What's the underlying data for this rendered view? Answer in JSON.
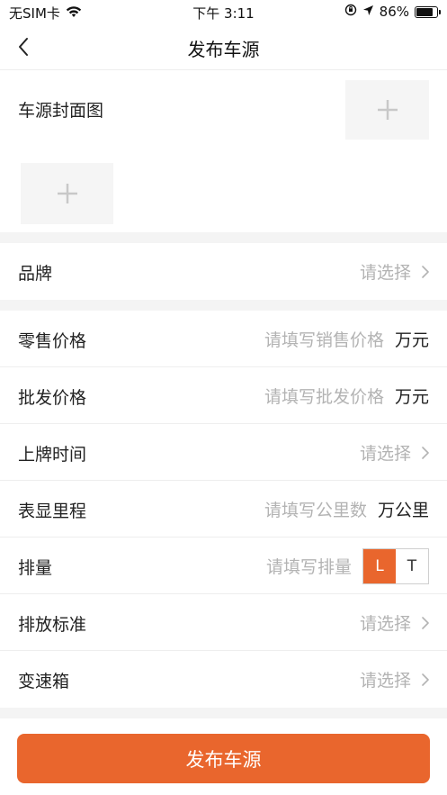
{
  "status": {
    "carrier": "无SIM卡",
    "time": "下午 3:11",
    "battery": "86%",
    "battery_level": 0.86
  },
  "nav": {
    "title": "发布车源"
  },
  "cover": {
    "label": "车源封面图"
  },
  "brand": {
    "label": "品牌",
    "placeholder": "请选择"
  },
  "retail_price": {
    "label": "零售价格",
    "placeholder": "请填写销售价格",
    "unit": "万元"
  },
  "wholesale_price": {
    "label": "批发价格",
    "placeholder": "请填写批发价格",
    "unit": "万元"
  },
  "registration_date": {
    "label": "上牌时间",
    "placeholder": "请选择"
  },
  "mileage": {
    "label": "表显里程",
    "placeholder": "请填写公里数",
    "unit": "万公里"
  },
  "displacement": {
    "label": "排量",
    "placeholder": "请填写排量",
    "options": [
      "L",
      "T"
    ],
    "selected": "L"
  },
  "emission_standard": {
    "label": "排放标准",
    "placeholder": "请选择"
  },
  "gearbox": {
    "label": "变速箱",
    "placeholder": "请选择"
  },
  "submit": {
    "label": "发布车源"
  },
  "colors": {
    "accent": "#e9662d",
    "placeholder": "#b3b3b3",
    "section_gap": "#f4f4f4"
  }
}
